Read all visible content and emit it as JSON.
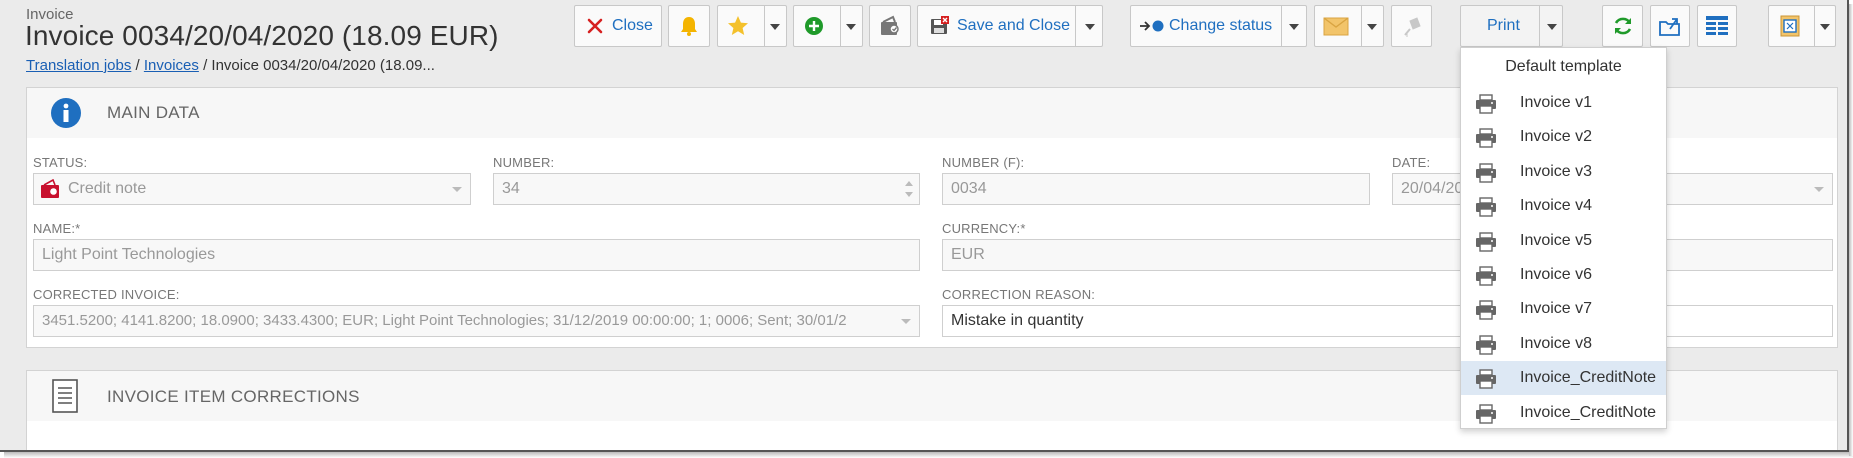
{
  "header": {
    "kind": "Invoice",
    "title": "Invoice 0034/20/04/2020 (18.09 EUR)"
  },
  "breadcrumb": {
    "items": [
      "Translation jobs",
      "Invoices"
    ],
    "separator": "/",
    "current": "Invoice 0034/20/04/2020 (18.09..."
  },
  "toolbar": {
    "close_label": "Close",
    "save_close_label": "Save and Close",
    "change_status_label": "Change status",
    "print_label": "Print"
  },
  "colors": {
    "accent": "#1f6fc0",
    "close_red": "#d62020",
    "refresh_green": "#1f9a2a",
    "bell_yellow": "#f4b400"
  },
  "main_data": {
    "title": "MAIN DATA",
    "status_label": "STATUS:",
    "status_value": "Credit note",
    "number_label": "NUMBER:",
    "number_value": "34",
    "number_f_label": "NUMBER (F):",
    "number_f_value": "0034",
    "date_label": "DATE:",
    "date_value": "20/04/20",
    "name_label": "NAME:*",
    "name_value": "Light Point Technologies",
    "currency_label": "CURRENCY:*",
    "currency_value": "EUR",
    "corrected_invoice_label": "CORRECTED INVOICE:",
    "corrected_invoice_value": "3451.5200; 4141.8200; 18.0900; 3433.4300; EUR; Light Point Technologies; 31/12/2019 00:00:00; 1; 0006; Sent; 30/01/2",
    "correction_reason_label": "CORRECTION REASON:",
    "correction_reason_value": "Mistake in quantity"
  },
  "corrections_panel": {
    "title": "INVOICE ITEM CORRECTIONS"
  },
  "print_menu": {
    "header": "Default template",
    "items": [
      "Invoice v1",
      "Invoice v2",
      "Invoice v3",
      "Invoice v4",
      "Invoice v5",
      "Invoice v6",
      "Invoice v7",
      "Invoice v8",
      "Invoice_CreditNote",
      "Invoice_CreditNote"
    ],
    "highlighted_index": 8
  }
}
